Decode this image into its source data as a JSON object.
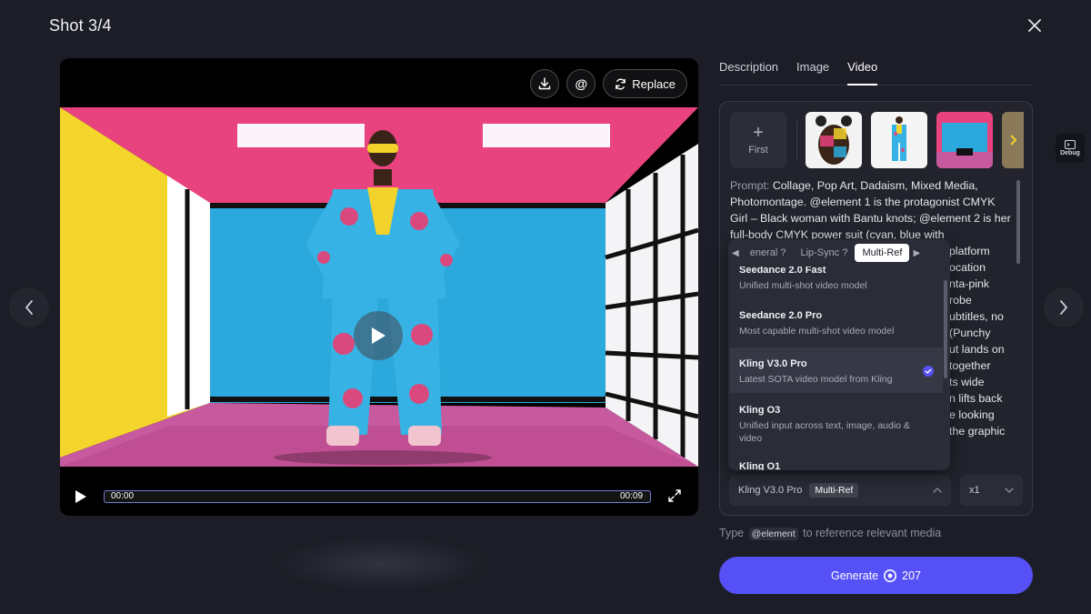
{
  "header": {
    "title": "Shot 3/4"
  },
  "player": {
    "replace_label": "Replace",
    "mention_symbol": "@",
    "time_current": "00:00",
    "time_total": "00:09",
    "progress": 0.0
  },
  "tabs": [
    {
      "label": "Description"
    },
    {
      "label": "Image"
    },
    {
      "label": "Video",
      "active": true
    }
  ],
  "references": {
    "first_label": "First",
    "plus": "+"
  },
  "prompt": {
    "label": "Prompt:",
    "text": "Collage, Pop Art, Dadaism, Mixed Media, Photomontage. @element 1 is the protagonist CMYK Girl – Black woman with Bantu knots; @element 2 is her full-body CMYK power suit (cyan, blue with",
    "overflow_lines": [
      "platform",
      "ocation",
      "nta-pink",
      "robe",
      "ubtitles, no",
      "(Punchy",
      "ut lands on",
      "together",
      "ts wide",
      "n lifts back",
      "e looking",
      "the graphic"
    ]
  },
  "model_popup": {
    "tabs": [
      {
        "label": "eneral",
        "info": "?"
      },
      {
        "label": "Lip-Sync",
        "info": "?"
      },
      {
        "label": "Multi-Ref",
        "active": true
      }
    ],
    "items": [
      {
        "name": "Seedance 2.0 Fast",
        "desc": "Unified multi-shot video model"
      },
      {
        "name": "Seedance 2.0 Pro",
        "desc": "Most capable multi-shot video model"
      },
      {
        "name": "Kling V3.0 Pro",
        "desc": "Latest SOTA video model from Kling",
        "selected": true
      },
      {
        "name": "Kling O3",
        "desc": "Unified input across text, image, audio & video"
      },
      {
        "name": "Kling O1",
        "desc": ""
      }
    ]
  },
  "model_select": {
    "name": "Kling V3.0 Pro",
    "badge": "Multi-Ref"
  },
  "count_select": {
    "value": "x1"
  },
  "hint": {
    "before": "Type",
    "tag": "@element",
    "after": "to reference relevant media"
  },
  "generate": {
    "label": "Generate",
    "cost": "207"
  },
  "debug": {
    "label": "Debug"
  },
  "colors": {
    "accent": "#5551f6",
    "background": "#1c1d26",
    "panel": "#22232d"
  }
}
